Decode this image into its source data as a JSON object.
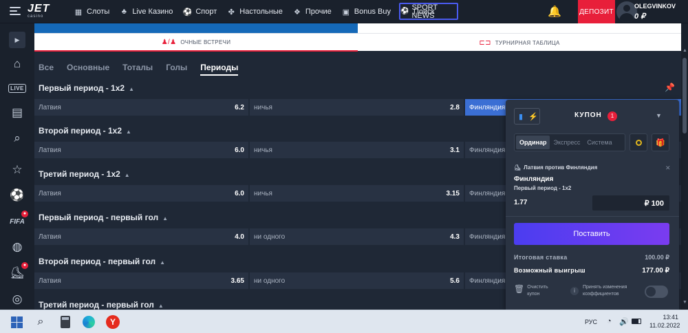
{
  "header": {
    "logo_main": "JET",
    "logo_sub": "casino",
    "nav": [
      {
        "label": "Слоты",
        "icon": "slots-icon"
      },
      {
        "label": "Live Казино",
        "icon": "live-casino-icon"
      },
      {
        "label": "Спорт",
        "icon": "sport-icon"
      },
      {
        "label": "Настольные",
        "icon": "table-games-icon"
      },
      {
        "label": "Прочие",
        "icon": "other-icon"
      },
      {
        "label": "Bonus Buy",
        "icon": "bonus-buy-icon"
      },
      {
        "label": "Поиск",
        "icon": "search-icon"
      }
    ],
    "sport_news": "SPORT NEWS",
    "deposit": "ДЕПОЗИТ",
    "username": "OLEGVINKOV",
    "balance": "0 ₽"
  },
  "tabs": {
    "matches": "ОЧНЫЕ ВСТРЕЧИ",
    "table": "ТУРНИРНАЯ ТАБЛИЦА"
  },
  "filters": [
    "Все",
    "Основные",
    "Тоталы",
    "Голы",
    "Периоды"
  ],
  "active_filter": "Периоды",
  "markets": [
    {
      "title": "Первый период - 1x2",
      "row": [
        {
          "label": "Латвия",
          "odd": "6.2"
        },
        {
          "label": "ничья",
          "odd": "2.8"
        },
        {
          "label": "Финляндия",
          "odd": ""
        }
      ]
    },
    {
      "title": "Второй период - 1x2",
      "row": [
        {
          "label": "Латвия",
          "odd": "6.0"
        },
        {
          "label": "ничья",
          "odd": "3.1"
        },
        {
          "label": "Финляндия",
          "odd": ""
        }
      ]
    },
    {
      "title": "Третий период - 1x2",
      "row": [
        {
          "label": "Латвия",
          "odd": "6.0"
        },
        {
          "label": "ничья",
          "odd": "3.15"
        },
        {
          "label": "Финляндия",
          "odd": ""
        }
      ]
    },
    {
      "title": "Первый период - первый гол",
      "row": [
        {
          "label": "Латвия",
          "odd": "4.0"
        },
        {
          "label": "ни одного",
          "odd": "4.3"
        },
        {
          "label": "Финляндия",
          "odd": ""
        }
      ]
    },
    {
      "title": "Второй период - первый гол",
      "row": [
        {
          "label": "Латвия",
          "odd": "3.65"
        },
        {
          "label": "ни одного",
          "odd": "5.6"
        },
        {
          "label": "Финляндия",
          "odd": ""
        }
      ]
    },
    {
      "title": "Третий период - первый гол",
      "row": [
        {
          "label": "",
          "odd": ""
        },
        {
          "label": "",
          "odd": ""
        },
        {
          "label": "",
          "odd": ""
        }
      ]
    }
  ],
  "coupon": {
    "title": "КУПОН",
    "count": "1",
    "types": [
      "Ординар",
      "Экспресс",
      "Система"
    ],
    "active_type": "Ординар",
    "match": "Латвия против Финляндия",
    "outcome": "Финляндия",
    "market": "Первый период - 1x2",
    "odd": "1.77",
    "stake": "₽ 100",
    "place_bet": "Поставить",
    "total_label": "Итоговая ставка",
    "total_value": "100.00 ₽",
    "win_label": "Возможный выигрыш",
    "win_value": "177.00 ₽",
    "clear": "Очистить купон",
    "accept_changes": "Принять изменения коэффициентов"
  },
  "taskbar": {
    "lang": "РУС",
    "time": "13:41",
    "date": "11.02.2022"
  }
}
